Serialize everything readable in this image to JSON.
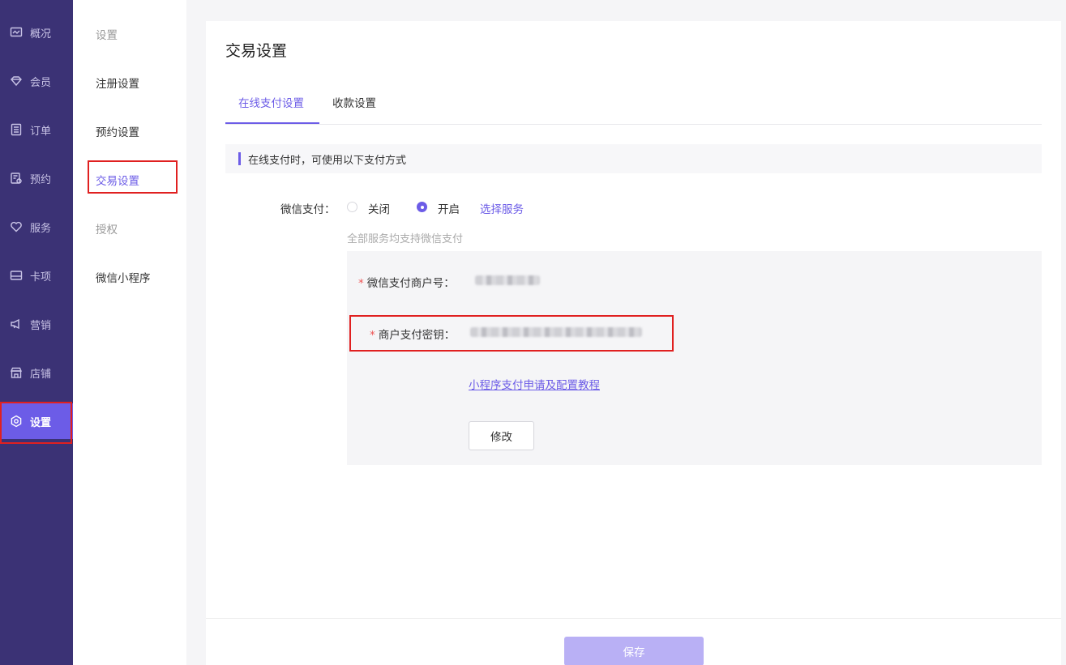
{
  "nav": {
    "items": [
      {
        "label": "概况",
        "icon": "chart-icon"
      },
      {
        "label": "会员",
        "icon": "diamond-icon"
      },
      {
        "label": "订单",
        "icon": "list-icon"
      },
      {
        "label": "预约",
        "icon": "calendar-icon"
      },
      {
        "label": "服务",
        "icon": "heart-icon"
      },
      {
        "label": "卡项",
        "icon": "card-icon"
      },
      {
        "label": "营销",
        "icon": "megaphone-icon"
      },
      {
        "label": "店铺",
        "icon": "store-icon"
      },
      {
        "label": "设置",
        "icon": "gear-icon",
        "active": true
      }
    ]
  },
  "subnav": {
    "header": "设置",
    "items": [
      "注册设置",
      "预约设置",
      "交易设置",
      "授权",
      "微信小程序"
    ],
    "active": "交易设置"
  },
  "page": {
    "title": "交易设置",
    "tabs": [
      {
        "label": "在线支付设置",
        "active": true
      },
      {
        "label": "收款设置",
        "active": false
      }
    ],
    "notice": "在线支付时，可使用以下支付方式"
  },
  "wechat_pay": {
    "label": "微信支付：",
    "option_off": "关闭",
    "option_on": "开启",
    "selected": "开启",
    "select_service": "选择服务",
    "hint": "全部服务均支持微信支付",
    "merchant_id_label": "微信支付商户号：",
    "merchant_key_label": "商户支付密钥：",
    "required_mark": "*",
    "tutorial_link": "小程序支付申请及配置教程",
    "edit_button": "修改"
  },
  "footer": {
    "save_button": "保存"
  },
  "colors": {
    "nav_bg": "#3b3275",
    "accent": "#6c5ce7",
    "save_disabled": "#b9b0f5",
    "highlight_box": "#e02020"
  }
}
